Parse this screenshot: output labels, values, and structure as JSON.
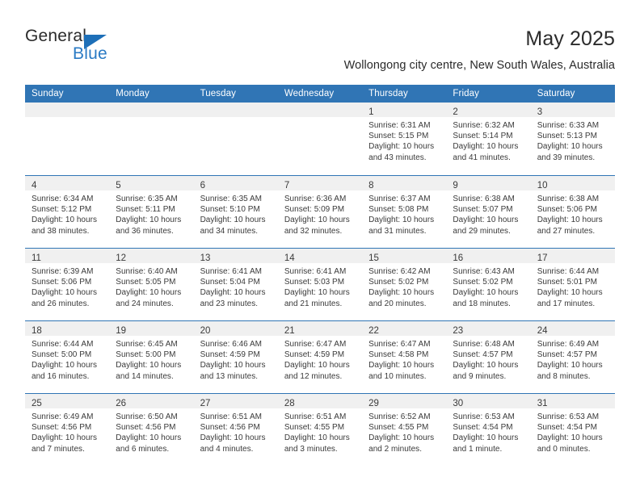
{
  "branding": {
    "word_general": "General",
    "word_blue": "Blue",
    "triangle_color": "#1d6fb8",
    "blue_text_color": "#2a7ac4"
  },
  "header": {
    "title": "May 2025",
    "subtitle": "Wollongong city centre, New South Wales, Australia",
    "header_bg": "#3075b5",
    "daynum_band_bg": "#f0f0f0"
  },
  "weekday_headers": [
    "Sunday",
    "Monday",
    "Tuesday",
    "Wednesday",
    "Thursday",
    "Friday",
    "Saturday"
  ],
  "weeks": [
    [
      {
        "day": "",
        "info": ""
      },
      {
        "day": "",
        "info": ""
      },
      {
        "day": "",
        "info": ""
      },
      {
        "day": "",
        "info": ""
      },
      {
        "day": "1",
        "info": "Sunrise: 6:31 AM\nSunset: 5:15 PM\nDaylight: 10 hours\nand 43 minutes."
      },
      {
        "day": "2",
        "info": "Sunrise: 6:32 AM\nSunset: 5:14 PM\nDaylight: 10 hours\nand 41 minutes."
      },
      {
        "day": "3",
        "info": "Sunrise: 6:33 AM\nSunset: 5:13 PM\nDaylight: 10 hours\nand 39 minutes."
      }
    ],
    [
      {
        "day": "4",
        "info": "Sunrise: 6:34 AM\nSunset: 5:12 PM\nDaylight: 10 hours\nand 38 minutes."
      },
      {
        "day": "5",
        "info": "Sunrise: 6:35 AM\nSunset: 5:11 PM\nDaylight: 10 hours\nand 36 minutes."
      },
      {
        "day": "6",
        "info": "Sunrise: 6:35 AM\nSunset: 5:10 PM\nDaylight: 10 hours\nand 34 minutes."
      },
      {
        "day": "7",
        "info": "Sunrise: 6:36 AM\nSunset: 5:09 PM\nDaylight: 10 hours\nand 32 minutes."
      },
      {
        "day": "8",
        "info": "Sunrise: 6:37 AM\nSunset: 5:08 PM\nDaylight: 10 hours\nand 31 minutes."
      },
      {
        "day": "9",
        "info": "Sunrise: 6:38 AM\nSunset: 5:07 PM\nDaylight: 10 hours\nand 29 minutes."
      },
      {
        "day": "10",
        "info": "Sunrise: 6:38 AM\nSunset: 5:06 PM\nDaylight: 10 hours\nand 27 minutes."
      }
    ],
    [
      {
        "day": "11",
        "info": "Sunrise: 6:39 AM\nSunset: 5:06 PM\nDaylight: 10 hours\nand 26 minutes."
      },
      {
        "day": "12",
        "info": "Sunrise: 6:40 AM\nSunset: 5:05 PM\nDaylight: 10 hours\nand 24 minutes."
      },
      {
        "day": "13",
        "info": "Sunrise: 6:41 AM\nSunset: 5:04 PM\nDaylight: 10 hours\nand 23 minutes."
      },
      {
        "day": "14",
        "info": "Sunrise: 6:41 AM\nSunset: 5:03 PM\nDaylight: 10 hours\nand 21 minutes."
      },
      {
        "day": "15",
        "info": "Sunrise: 6:42 AM\nSunset: 5:02 PM\nDaylight: 10 hours\nand 20 minutes."
      },
      {
        "day": "16",
        "info": "Sunrise: 6:43 AM\nSunset: 5:02 PM\nDaylight: 10 hours\nand 18 minutes."
      },
      {
        "day": "17",
        "info": "Sunrise: 6:44 AM\nSunset: 5:01 PM\nDaylight: 10 hours\nand 17 minutes."
      }
    ],
    [
      {
        "day": "18",
        "info": "Sunrise: 6:44 AM\nSunset: 5:00 PM\nDaylight: 10 hours\nand 16 minutes."
      },
      {
        "day": "19",
        "info": "Sunrise: 6:45 AM\nSunset: 5:00 PM\nDaylight: 10 hours\nand 14 minutes."
      },
      {
        "day": "20",
        "info": "Sunrise: 6:46 AM\nSunset: 4:59 PM\nDaylight: 10 hours\nand 13 minutes."
      },
      {
        "day": "21",
        "info": "Sunrise: 6:47 AM\nSunset: 4:59 PM\nDaylight: 10 hours\nand 12 minutes."
      },
      {
        "day": "22",
        "info": "Sunrise: 6:47 AM\nSunset: 4:58 PM\nDaylight: 10 hours\nand 10 minutes."
      },
      {
        "day": "23",
        "info": "Sunrise: 6:48 AM\nSunset: 4:57 PM\nDaylight: 10 hours\nand 9 minutes."
      },
      {
        "day": "24",
        "info": "Sunrise: 6:49 AM\nSunset: 4:57 PM\nDaylight: 10 hours\nand 8 minutes."
      }
    ],
    [
      {
        "day": "25",
        "info": "Sunrise: 6:49 AM\nSunset: 4:56 PM\nDaylight: 10 hours\nand 7 minutes."
      },
      {
        "day": "26",
        "info": "Sunrise: 6:50 AM\nSunset: 4:56 PM\nDaylight: 10 hours\nand 6 minutes."
      },
      {
        "day": "27",
        "info": "Sunrise: 6:51 AM\nSunset: 4:56 PM\nDaylight: 10 hours\nand 4 minutes."
      },
      {
        "day": "28",
        "info": "Sunrise: 6:51 AM\nSunset: 4:55 PM\nDaylight: 10 hours\nand 3 minutes."
      },
      {
        "day": "29",
        "info": "Sunrise: 6:52 AM\nSunset: 4:55 PM\nDaylight: 10 hours\nand 2 minutes."
      },
      {
        "day": "30",
        "info": "Sunrise: 6:53 AM\nSunset: 4:54 PM\nDaylight: 10 hours\nand 1 minute."
      },
      {
        "day": "31",
        "info": "Sunrise: 6:53 AM\nSunset: 4:54 PM\nDaylight: 10 hours\nand 0 minutes."
      }
    ]
  ]
}
